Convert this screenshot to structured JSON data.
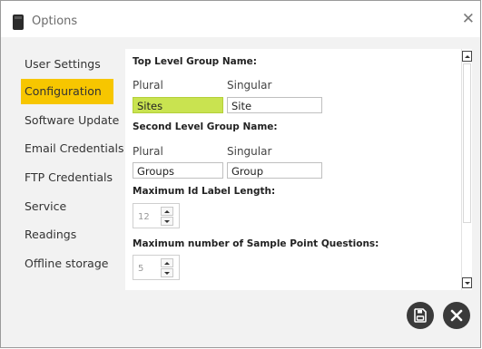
{
  "window": {
    "title": "Options",
    "close_glyph": "✕"
  },
  "sidebar": {
    "items": [
      {
        "label": "User Settings",
        "active": false
      },
      {
        "label": "Configuration",
        "active": true
      },
      {
        "label": "Software Update",
        "active": false
      },
      {
        "label": "Email Credentials",
        "active": false
      },
      {
        "label": "FTP Credentials",
        "active": false
      },
      {
        "label": "Service",
        "active": false
      },
      {
        "label": "Readings",
        "active": false
      },
      {
        "label": "Offline storage",
        "active": false
      }
    ],
    "active_color": "#f7c600"
  },
  "config": {
    "top_level": {
      "heading": "Top Level Group Name:",
      "plural_label": "Plural",
      "singular_label": "Singular",
      "plural_value": "Sites",
      "singular_value": "Site"
    },
    "second_level": {
      "heading": "Second Level Group Name:",
      "plural_label": "Plural",
      "singular_label": "Singular",
      "plural_value": "Groups",
      "singular_value": "Group"
    },
    "max_id_label": {
      "heading": "Maximum Id Label Length:",
      "value": "12"
    },
    "max_sample_questions": {
      "heading": "Maximum number of Sample Point Questions:",
      "value": "5"
    },
    "highlight_color": "#c9e350"
  },
  "icons": {
    "app": "app-icon",
    "save": "save-icon",
    "cancel": "cancel-icon"
  }
}
